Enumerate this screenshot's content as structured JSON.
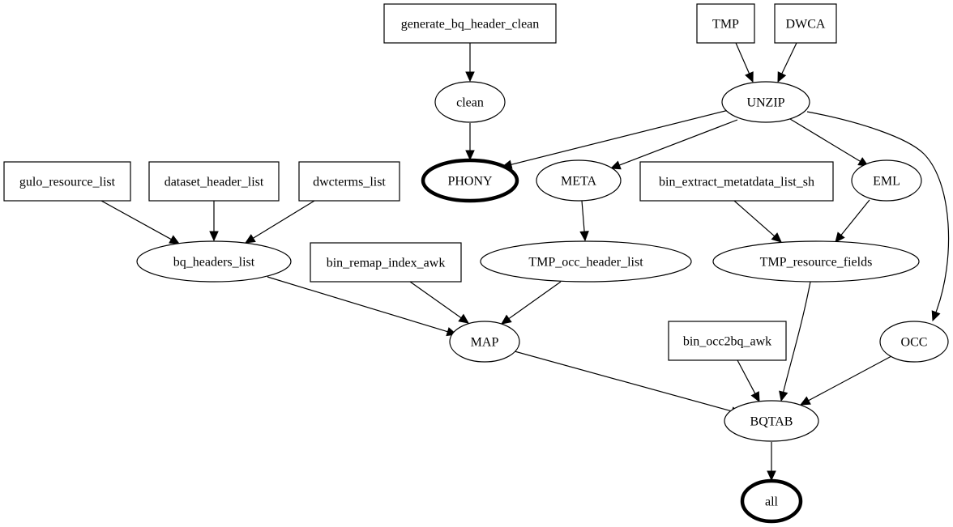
{
  "diagram": {
    "type": "directed-graph",
    "nodes": [
      {
        "id": "generate_bq_header_clean",
        "label": "generate_bq_header_clean",
        "shape": "box",
        "bold": false
      },
      {
        "id": "TMP",
        "label": "TMP",
        "shape": "box",
        "bold": false
      },
      {
        "id": "DWCA",
        "label": "DWCA",
        "shape": "box",
        "bold": false
      },
      {
        "id": "clean",
        "label": "clean",
        "shape": "ellipse",
        "bold": false
      },
      {
        "id": "UNZIP",
        "label": "UNZIP",
        "shape": "ellipse",
        "bold": false
      },
      {
        "id": "gulo_resource_list",
        "label": "gulo_resource_list",
        "shape": "box",
        "bold": false
      },
      {
        "id": "dataset_header_list",
        "label": "dataset_header_list",
        "shape": "box",
        "bold": false
      },
      {
        "id": "dwcterms_list",
        "label": "dwcterms_list",
        "shape": "box",
        "bold": false
      },
      {
        "id": "PHONY",
        "label": "PHONY",
        "shape": "ellipse",
        "bold": true
      },
      {
        "id": "META",
        "label": "META",
        "shape": "ellipse",
        "bold": false
      },
      {
        "id": "bin_extract_metatdata_list_sh",
        "label": "bin_extract_metatdata_list_sh",
        "shape": "box",
        "bold": false
      },
      {
        "id": "EML",
        "label": "EML",
        "shape": "ellipse",
        "bold": false
      },
      {
        "id": "bq_headers_list",
        "label": "bq_headers_list",
        "shape": "ellipse",
        "bold": false
      },
      {
        "id": "bin_remap_index_awk",
        "label": "bin_remap_index_awk",
        "shape": "box",
        "bold": false
      },
      {
        "id": "TMP_occ_header_list",
        "label": "TMP_occ_header_list",
        "shape": "ellipse",
        "bold": false
      },
      {
        "id": "TMP_resource_fields",
        "label": "TMP_resource_fields",
        "shape": "ellipse",
        "bold": false
      },
      {
        "id": "MAP",
        "label": "MAP",
        "shape": "ellipse",
        "bold": false
      },
      {
        "id": "bin_occ2bq_awk",
        "label": "bin_occ2bq_awk",
        "shape": "box",
        "bold": false
      },
      {
        "id": "OCC",
        "label": "OCC",
        "shape": "ellipse",
        "bold": false
      },
      {
        "id": "BQTAB",
        "label": "BQTAB",
        "shape": "ellipse",
        "bold": false
      },
      {
        "id": "all",
        "label": "all",
        "shape": "ellipse",
        "bold": true
      }
    ],
    "edges": [
      {
        "from": "generate_bq_header_clean",
        "to": "clean"
      },
      {
        "from": "clean",
        "to": "PHONY"
      },
      {
        "from": "TMP",
        "to": "UNZIP"
      },
      {
        "from": "DWCA",
        "to": "UNZIP"
      },
      {
        "from": "UNZIP",
        "to": "PHONY"
      },
      {
        "from": "UNZIP",
        "to": "META"
      },
      {
        "from": "UNZIP",
        "to": "EML"
      },
      {
        "from": "UNZIP",
        "to": "OCC"
      },
      {
        "from": "gulo_resource_list",
        "to": "bq_headers_list"
      },
      {
        "from": "dataset_header_list",
        "to": "bq_headers_list"
      },
      {
        "from": "dwcterms_list",
        "to": "bq_headers_list"
      },
      {
        "from": "META",
        "to": "TMP_occ_header_list"
      },
      {
        "from": "bin_extract_metatdata_list_sh",
        "to": "TMP_resource_fields"
      },
      {
        "from": "EML",
        "to": "TMP_resource_fields"
      },
      {
        "from": "bq_headers_list",
        "to": "MAP"
      },
      {
        "from": "bin_remap_index_awk",
        "to": "MAP"
      },
      {
        "from": "TMP_occ_header_list",
        "to": "MAP"
      },
      {
        "from": "MAP",
        "to": "BQTAB"
      },
      {
        "from": "bin_occ2bq_awk",
        "to": "BQTAB"
      },
      {
        "from": "TMP_resource_fields",
        "to": "BQTAB"
      },
      {
        "from": "OCC",
        "to": "BQTAB"
      },
      {
        "from": "BQTAB",
        "to": "all"
      }
    ]
  }
}
